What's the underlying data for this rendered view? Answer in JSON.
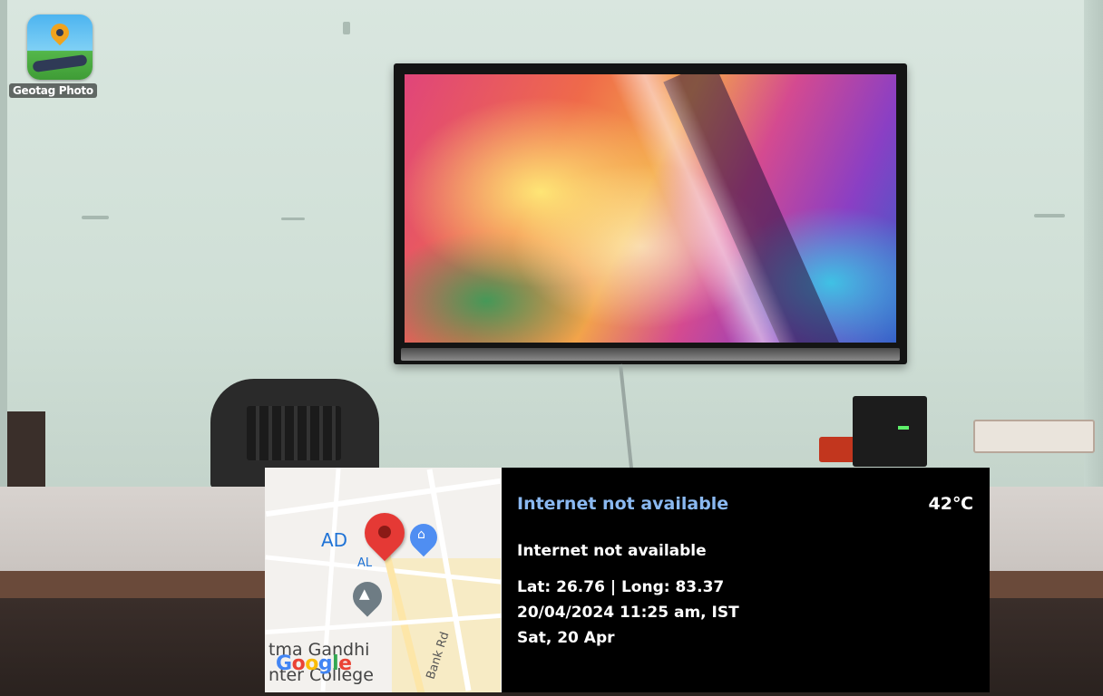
{
  "app": {
    "icon_name": "geotag-photo-app-icon",
    "label": "Geotag Photo"
  },
  "map": {
    "place_label_1": "AD",
    "place_label_2": "AL",
    "college_line_1": "tma Gandhi",
    "college_line_2": "nter College",
    "street_label": "Bank Rd",
    "attribution": "Google",
    "markers": [
      "location-pin-icon",
      "shopping-bag-pin-icon",
      "graduation-cap-pin-icon"
    ]
  },
  "overlay": {
    "title": "Internet not available",
    "temperature": "42℃",
    "address": "Internet not available",
    "coordinates": "Lat: 26.76 | Long: 83.37",
    "datetime": "20/04/2024  11:25 am, IST",
    "day": "Sat, 20 Apr"
  },
  "colors": {
    "overlay_bg": "#000000",
    "title_color": "#8ab8f0",
    "pin_red": "#e53935",
    "map_label_blue": "#1f73d6"
  }
}
